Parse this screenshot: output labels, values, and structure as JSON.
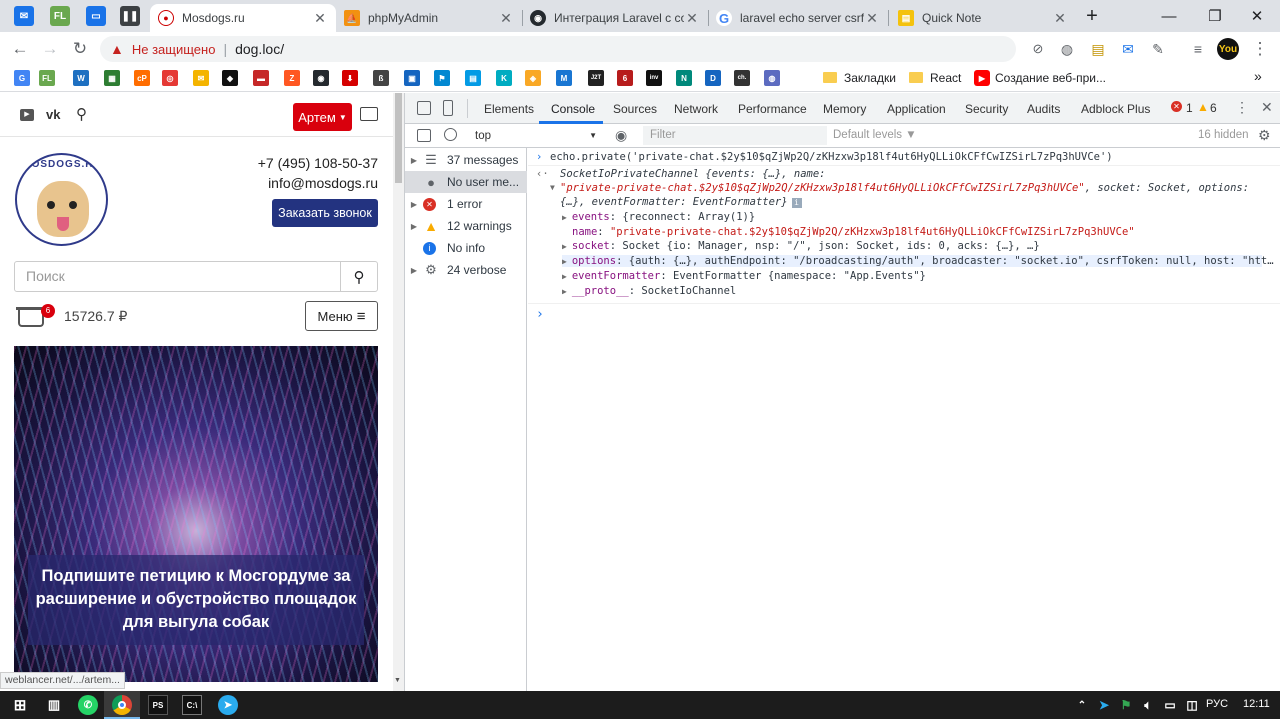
{
  "browser": {
    "tabs": [
      {
        "title": "Mosdogs.ru",
        "active": true
      },
      {
        "title": "phpMyAdmin",
        "active": false
      },
      {
        "title": "Интеграция Laravel с со",
        "active": false
      },
      {
        "title": "laravel echo server csrf to",
        "active": false
      },
      {
        "title": "Quick Note",
        "active": false
      }
    ],
    "new_tab": "+",
    "window_controls": {
      "minimize": "—",
      "maximize": "❐",
      "close": "✕"
    },
    "security_label": "Не защищено",
    "url": "dog.loc/",
    "bookmarks_bar": {
      "icon_labels": [
        "G",
        "FL",
        "W",
        "▦",
        "cP",
        "◎",
        "✉",
        "◆",
        "▬",
        "Z",
        "◉",
        "⬇",
        "ß",
        "▣",
        "⚑",
        "▤",
        "K",
        "◈",
        "M",
        "J2T",
        "6",
        "inv",
        "N",
        "D",
        "ch.",
        "◍"
      ],
      "folder1": "Закладки",
      "folder2": "React",
      "youtube_item": "Создание веб-при...",
      "more": "»"
    }
  },
  "website": {
    "social_icons": [
      "youtube-icon",
      "vk-icon",
      "ok-icon"
    ],
    "user_button": "Артем",
    "phone": "+7 (495) 108-50-37",
    "email": "info@mosdogs.ru",
    "callback_button": "Заказать звонок",
    "logo_text": "MOSDOGS.RU",
    "search_placeholder": "Поиск",
    "cart_count": "6",
    "cart_total": "15726.7 ₽",
    "menu_button": "Меню",
    "banner_text": "Подпишите петицию к Мосгордуме за расширение и обустройство площадок для выгула собак",
    "status_url": "weblancer.net/.../artem..."
  },
  "devtools": {
    "tabs": [
      "Elements",
      "Console",
      "Sources",
      "Network",
      "Performance",
      "Memory",
      "Application",
      "Security",
      "Audits",
      "Adblock Plus"
    ],
    "active_tab": "Console",
    "error_count": "1",
    "warning_count": "6",
    "context": "top",
    "filter_placeholder": "Filter",
    "levels": "Default levels ▼",
    "hidden": "16 hidden",
    "sidebar": [
      {
        "label": "37 messages",
        "icon": "list-icon"
      },
      {
        "label": "No user me...",
        "icon": "user-icon"
      },
      {
        "label": "1 error",
        "icon": "error-icon"
      },
      {
        "label": "12 warnings",
        "icon": "warning-icon"
      },
      {
        "label": "No info",
        "icon": "info-icon"
      },
      {
        "label": "24 verbose",
        "icon": "gear-icon"
      }
    ],
    "console": {
      "input": "echo.private('private-chat.$2y$10$qZjWp2Q/zKHzxw3p18lf4ut6HyQLLiOkCFfCwIZSirL7zPq3hUVCe')",
      "result_class": "SocketIoPrivateChannel",
      "result_head": " {events: {…}, name:",
      "result_name_str": "\"private-private-chat.$2y$10$qZjWp2Q/zKHzxw3p18lf4ut6HyQLLiOkCFfCwIZSirL7zPq3hUVCe\"",
      "result_tail1": ", socket: Socket, options:",
      "result_tail2": "{…}, eventFormatter: EventFormatter}",
      "props": [
        {
          "key": "events",
          "value": "{reconnect: Array(1)}"
        },
        {
          "key": "name",
          "value": "\"private-private-chat.$2y$10$qZjWp2Q/zKHzxw3p18lf4ut6HyQLLiOkCFfCwIZSirL7zPq3hUVCe\""
        },
        {
          "key": "socket",
          "value": "Socket {io: Manager, nsp: \"/\", json: Socket, ids: 0, acks: {…}, …}"
        },
        {
          "key": "options",
          "value": "{auth: {…}, authEndpoint: \"/broadcasting/auth\", broadcaster: \"socket.io\", csrfToken: null, host: \"htt…"
        },
        {
          "key": "eventFormatter",
          "value": "EventFormatter {namespace: \"App.Events\"}"
        },
        {
          "key": "__proto__",
          "value": "SocketIoChannel"
        }
      ]
    }
  },
  "taskbar": {
    "language": "РУС",
    "time": "12:11"
  }
}
